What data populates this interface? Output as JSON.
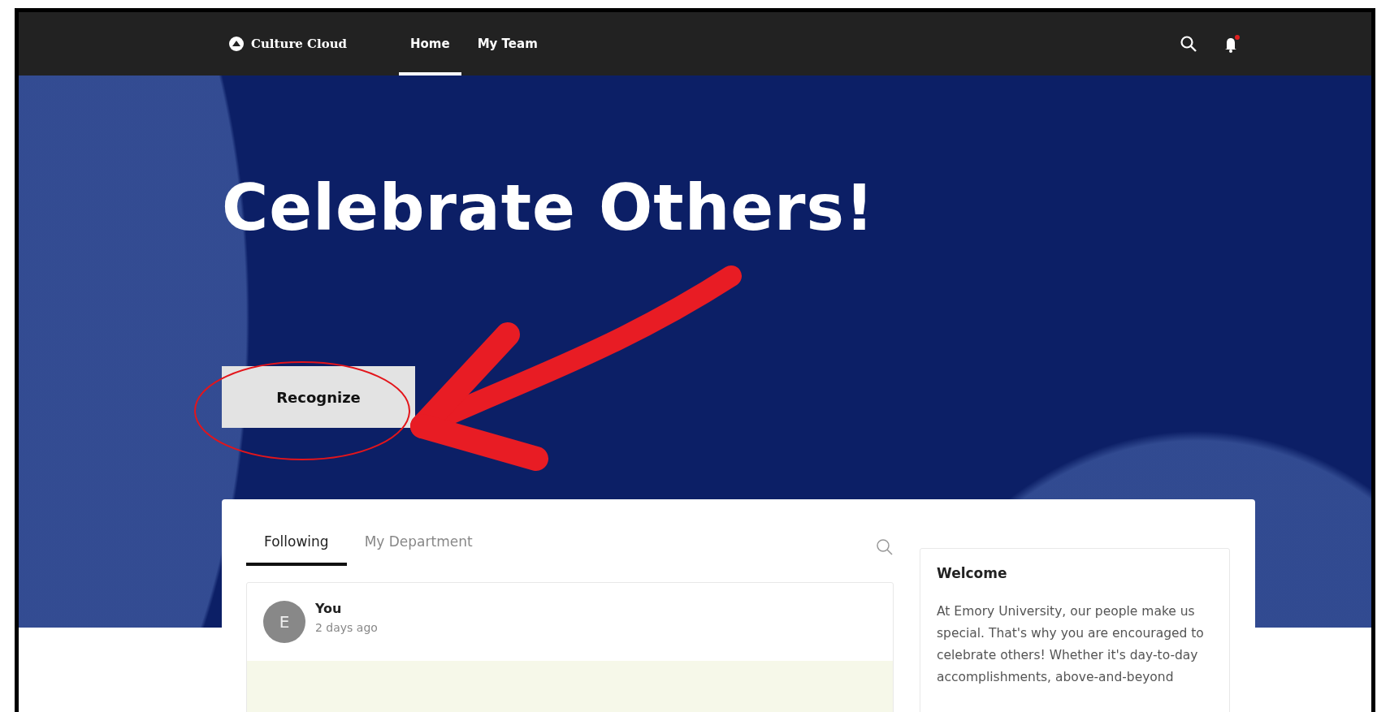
{
  "nav": {
    "logo": "Culture Cloud",
    "links": [
      {
        "label": "Home",
        "selected": true
      },
      {
        "label": "My Team",
        "selected": false
      }
    ],
    "notifications_unread": true
  },
  "hero": {
    "title": "Celebrate Others!",
    "button": "Recognize"
  },
  "feed": {
    "tabs": [
      {
        "label": "Following",
        "selected": true
      },
      {
        "label": "My Department",
        "selected": false
      }
    ],
    "post": {
      "avatar": "E",
      "author": "You",
      "time": "2 days ago"
    }
  },
  "welcome": {
    "title": "Welcome",
    "text": "At Emory University, our people make us special. That's why you are encouraged to celebrate others! Whether it's day-to-day accomplishments, above-and-beyond"
  }
}
